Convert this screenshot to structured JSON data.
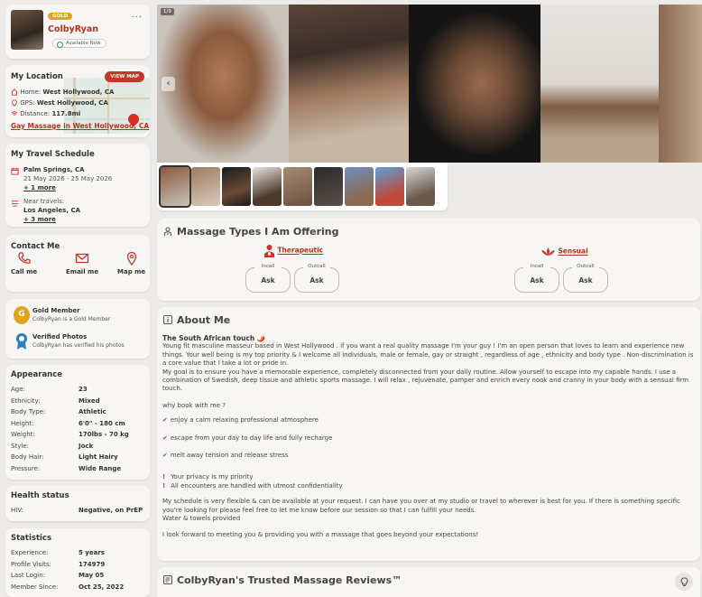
{
  "profile": {
    "badge": "GOLD",
    "name": "ColbyRyan",
    "status": "Available Now",
    "menu": "..."
  },
  "location": {
    "title": "My Location",
    "view_map": "VIEW MAP",
    "home_label": "Home:",
    "home_value": "West Hollywood, CA",
    "gps_label": "GPS:",
    "gps_value": "West Hollywood, CA",
    "distance_label": "Distance:",
    "distance_value": "117.8mi",
    "link": "Gay Massage in West Hollywood, CA"
  },
  "travel": {
    "title": "My Travel Schedule",
    "trip_city": "Palm Springs, CA",
    "trip_dates": "21 May 2026 - 25 May 2026",
    "trip_more": "+ 1 more",
    "near_label": "Near travels:",
    "near_city": "Los Angeles, CA",
    "near_more": "+ 3 more"
  },
  "contact": {
    "title": "Contact Me",
    "call": "Call me",
    "email": "Email me",
    "map": "Map me"
  },
  "badges": {
    "gold_title": "Gold Member",
    "gold_desc": "ColbyRyan is a Gold Member",
    "verified_title": "Verified Photos",
    "verified_desc": "ColbyRyan has verified his photos"
  },
  "appearance": {
    "title": "Appearance",
    "rows": [
      {
        "k": "Age:",
        "v": "23"
      },
      {
        "k": "Ethnicity:",
        "v": "Mixed"
      },
      {
        "k": "Body Type:",
        "v": "Athletic"
      },
      {
        "k": "Height:",
        "v": "6'0\" - 180 cm"
      },
      {
        "k": "Weight:",
        "v": "170lbs - 70 kg"
      },
      {
        "k": "Style:",
        "v": "Jock"
      },
      {
        "k": "Body Hair:",
        "v": "Light Hairy"
      },
      {
        "k": "Pressure:",
        "v": "Wide Range"
      }
    ]
  },
  "health": {
    "title": "Health status",
    "k": "HIV:",
    "v": "Negative, on PrEP"
  },
  "statistics": {
    "title": "Statistics",
    "rows": [
      {
        "k": "Experience:",
        "v": "5 years"
      },
      {
        "k": "Profile Visits:",
        "v": "174979"
      },
      {
        "k": "Last Login:",
        "v": "May 05"
      },
      {
        "k": "Member Since:",
        "v": "Oct 25, 2022"
      }
    ]
  },
  "gallery": {
    "counter": "1/9",
    "prev": "‹"
  },
  "massage": {
    "title": "Massage Types I Am Offering",
    "types": [
      {
        "name": "Therapeutic",
        "incall_label": "Incall",
        "incall_value": "Ask",
        "outcall_label": "Outcall",
        "outcall_value": "Ask"
      },
      {
        "name": "Sensual",
        "incall_label": "Incall",
        "incall_value": "Ask",
        "outcall_label": "Outcall",
        "outcall_value": "Ask"
      }
    ]
  },
  "about": {
    "title": "About Me",
    "tagline": "The South African touch 🌶️",
    "intro1": "Young fit masculine masseur based in West Hollywood . if you want a real quality massage I'm your guy ! I'm an open person that loves to learn and experience new things. Your well being is my top priority & I welcome all individuals, male or female, gay or straight , regardless of age , ethnicity and body type . Non-discrimination is a core value that I take a lot or pride in.",
    "intro2": "My goal is to ensure you have a memorable experience, completely disconnected from your daily routine. Allow yourself to escape into my capable hands. I use a combination of Swedish, deep tissue and athletic sports massage. I will relax , rejuvenate, pamper and enrich every nook and cranny in your body with a sensual firm touch.",
    "why": "why book with me ?",
    "bullet1": "enjoy a calm relaxing professional atmosphere",
    "bullet2": "escape from your day to day life and fully recharge",
    "bullet3": "melt away tension and release stress",
    "priority1": "Your privacy is my priority",
    "priority2": "All encounters are handled with utmost confidentiality",
    "schedule1": "My schedule is very flexible & can be available at your request. I can have you over at my studio or travel to wherever is best for you. If there is something specific you're looking for please feel free to let me know before our session so that I can fulfill your needs.",
    "schedule2": "Water & towels provided",
    "closing": "I look forward to meeting you & providing you with a massage that goes beyond your expectations!"
  },
  "reviews": {
    "title": "ColbyRyan's Trusted Massage Reviews™"
  },
  "colors": {
    "accent": "#b0341f",
    "gold": "#e0a31b",
    "background": "#ecebe9",
    "card": "#f7f6f4"
  }
}
